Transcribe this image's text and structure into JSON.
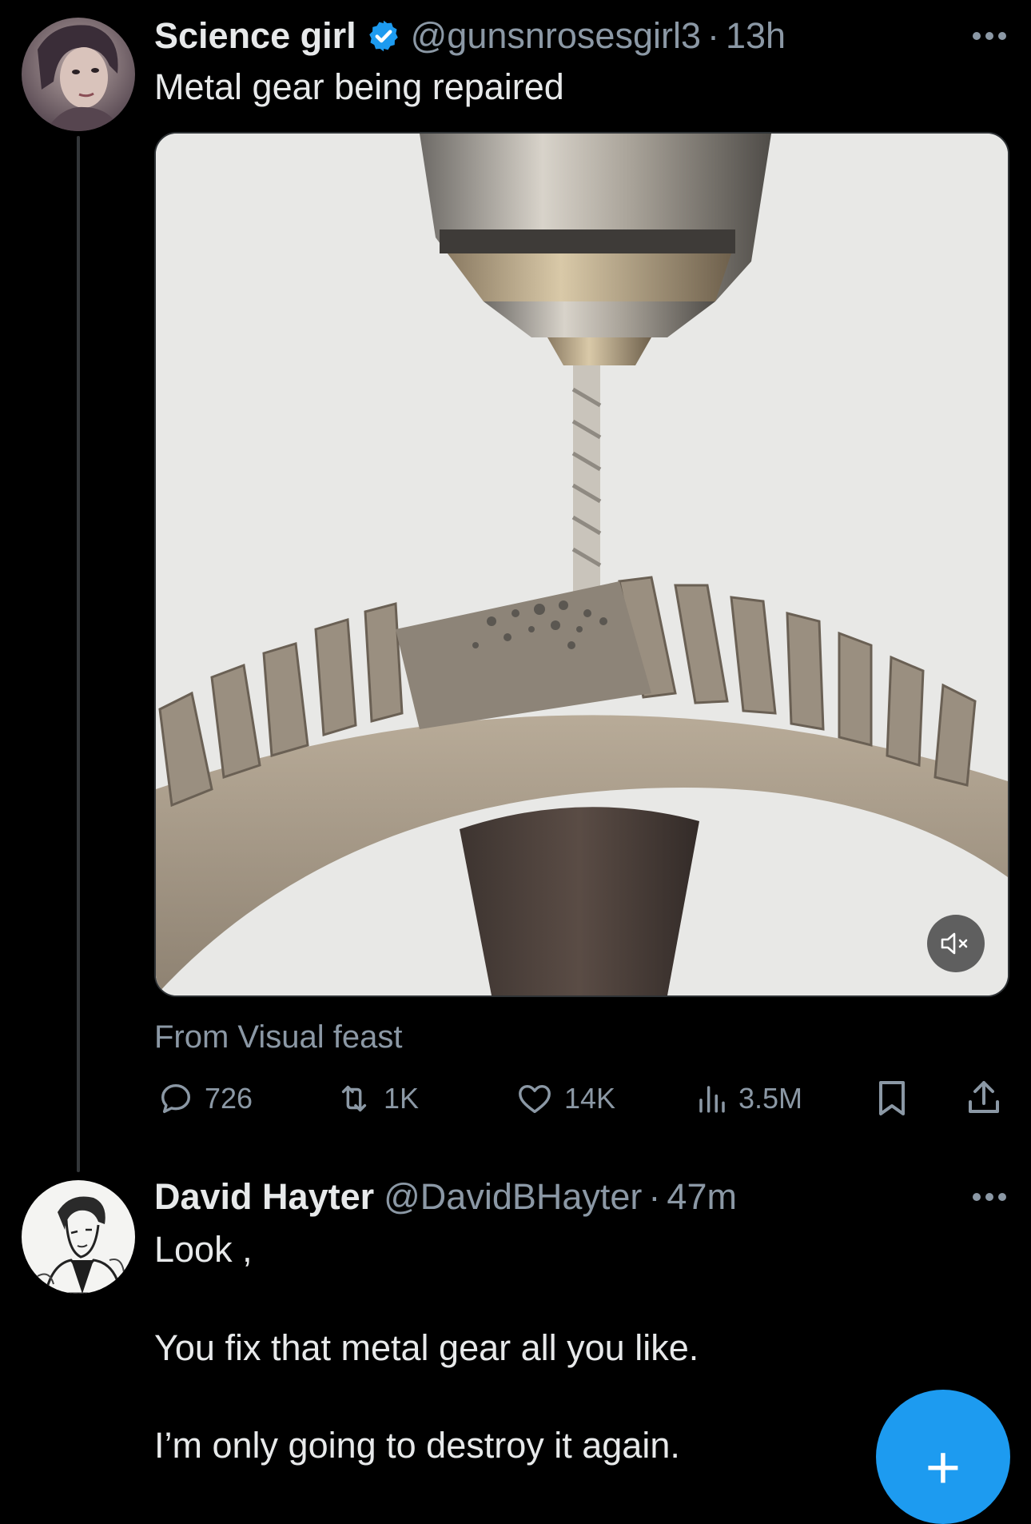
{
  "colors": {
    "background": "#000000",
    "text_primary": "#e7e9ea",
    "text_secondary": "#8b98a5",
    "accent": "#1d9bf0"
  },
  "tweet1": {
    "display_name": "Science girl",
    "verified": true,
    "handle": "@gunsnrosesgirl3",
    "separator": "·",
    "time": "13h",
    "text": "Metal gear being repaired",
    "media": {
      "type": "video",
      "content": "drill bit boring into a worn gear rack",
      "muted": true
    },
    "source": "From Visual feast",
    "actions": {
      "replies": "726",
      "reposts": "1K",
      "likes": "14K",
      "views": "3.5M"
    }
  },
  "tweet2": {
    "display_name": "David Hayter",
    "verified": false,
    "handle": "@DavidBHayter",
    "separator": "·",
    "time": "47m",
    "lines": [
      "Look ,",
      "You fix that metal gear all you like.",
      "I’m only going to destroy it again."
    ]
  },
  "fab": {
    "label": "+"
  },
  "icons": [
    "more-icon",
    "verified-badge-icon",
    "reply-icon",
    "repost-icon",
    "like-icon",
    "views-icon",
    "bookmark-icon",
    "share-icon",
    "mute-icon",
    "plus-icon"
  ]
}
